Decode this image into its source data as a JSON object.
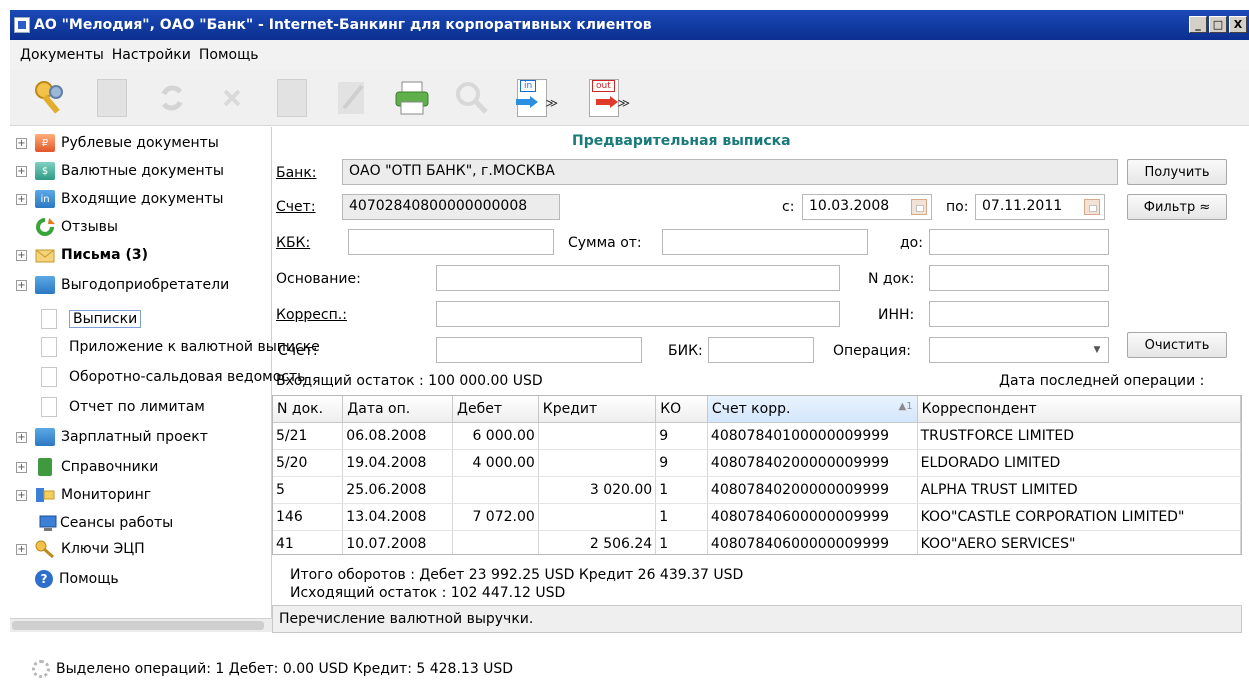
{
  "window": {
    "title": "АО \"Мелодия\", ОАО \"Банк\" - Internet-Банкинг для корпоративных клиентов",
    "controls": [
      "_",
      "□",
      "X"
    ]
  },
  "menu": [
    "Документы",
    "Настройки",
    "Помощь"
  ],
  "toolbar": {
    "in_tag": "in",
    "out_tag": "out",
    "chevron": "≫",
    "icons": [
      "keys-icon",
      "new-document-icon",
      "refresh-icon",
      "delete-icon",
      "copy-icon",
      "edit-icon",
      "print-icon",
      "search-icon",
      "import-icon",
      "export-icon"
    ]
  },
  "sidebar": {
    "items": [
      {
        "label": "Рублевые документы",
        "expandable": true,
        "icon": "folder-rub-icon",
        "badge": "₽"
      },
      {
        "label": "Валютные документы",
        "expandable": true,
        "icon": "folder-usd-icon",
        "badge": "$"
      },
      {
        "label": "Входящие документы",
        "expandable": true,
        "icon": "folder-in-icon",
        "badge": "in"
      },
      {
        "label": "Отзывы",
        "expandable": false,
        "icon": "recall-icon"
      },
      {
        "label": "Письма (3)",
        "expandable": true,
        "icon": "letters-icon"
      },
      {
        "label": "Выгодоприобретатели",
        "expandable": true,
        "icon": "folder-icon"
      },
      {
        "label": "Выписки",
        "expandable": false,
        "icon": "document-icon",
        "selected": true
      },
      {
        "label": "Приложение к валютной выписке",
        "expandable": false,
        "icon": "document-icon"
      },
      {
        "label": "Оборотно-сальдовая ведомость",
        "expandable": false,
        "icon": "document-icon"
      },
      {
        "label": "Отчет по лимитам",
        "expandable": false,
        "icon": "document-icon"
      },
      {
        "label": "Зарплатный проект",
        "expandable": true,
        "icon": "folder-icon"
      },
      {
        "label": "Справочники",
        "expandable": true,
        "icon": "directory-icon"
      },
      {
        "label": "Мониторинг",
        "expandable": true,
        "icon": "monitoring-icon"
      },
      {
        "label": "Сеансы работы",
        "expandable": false,
        "icon": "sessions-icon"
      },
      {
        "label": "Ключи ЭЦП",
        "expandable": true,
        "icon": "keys-icon"
      },
      {
        "label": "Помощь",
        "expandable": false,
        "icon": "help-icon"
      }
    ]
  },
  "statement": {
    "title": "Предварительная выписка",
    "bank_label": "Банк:",
    "bank_value": "ОАО \"ОТП БАНК\", г.МОСКВА",
    "get_button": "Получить",
    "account_label": "Счет:",
    "account_value": "40702840800000000008",
    "from_label": "с:",
    "from_date": "10.03.2008",
    "to_label": "по:",
    "to_date": "07.11.2011",
    "filter_button": "Фильтр ≈",
    "kbk_label": "КБК:",
    "sum_from_label": "Сумма от:",
    "sum_to_label": "до:",
    "basis_label": "Основание:",
    "doc_no_label": "N док:",
    "corresp_label": "Корресп.:",
    "inn_label": "ИНН:",
    "account2_label": "Счет:",
    "bik_label": "БИК:",
    "operation_label": "Операция:",
    "clear_button": "Очистить",
    "opening_balance": "Входящий остаток : 100 000.00  USD",
    "last_op_label": "Дата последней операции :"
  },
  "table": {
    "columns": [
      "N док.",
      "Дата оп.",
      "Дебет",
      "Кредит",
      "КО",
      "Счет корр.",
      "Корреспондент"
    ],
    "sort_indicator": "▲1",
    "rows": [
      [
        "5/21",
        "06.08.2008",
        "6 000.00",
        "",
        "9",
        "40807840100000009999",
        "TRUSTFORCE LIMITED"
      ],
      [
        "5/20",
        "19.04.2008",
        "4 000.00",
        "",
        "9",
        "40807840200000009999",
        "ELDORADO LIMITED"
      ],
      [
        "5",
        "25.06.2008",
        "",
        "3 020.00",
        "1",
        "40807840200000009999",
        "ALPHA TRUST LIMITED"
      ],
      [
        "146",
        "13.04.2008",
        "7 072.00",
        "",
        "1",
        "40807840600000009999",
        "KOO\"CASTLE CORPORATION LIMITED\""
      ],
      [
        "41",
        "10.07.2008",
        "",
        "2 506.24",
        "1",
        "40807840600000009999",
        "KOO\"AERO SERVICES\""
      ]
    ]
  },
  "totals": {
    "turnover": "Итого оборотов : Дебет  23 992.25  USD  Кредит  26 439.37  USD",
    "closing_balance": "Исходящий остаток : 102 447.12  USD"
  },
  "description": "Перечисление валютной выручки.",
  "status": "Выделено операций: 1 Дебет: 0.00 USD Кредит: 5 428.13 USD",
  "colors": {
    "title_bar": "#0b3aa6",
    "panel_title": "#1a7a7a",
    "selection_border": "#7fa0d6"
  }
}
